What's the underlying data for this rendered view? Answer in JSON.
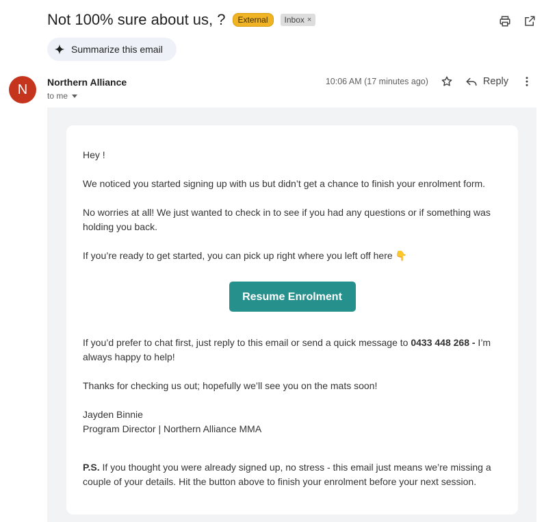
{
  "header": {
    "subject": "Not 100% sure about us, ?",
    "badge_external": "External",
    "badge_inbox": "Inbox",
    "badge_inbox_close": "×"
  },
  "toolbar": {
    "print_icon": "printer-icon",
    "open_new_window_icon": "open-in-new-icon"
  },
  "summarize": {
    "label": "Summarize this email",
    "icon": "sparkle-icon"
  },
  "message": {
    "avatar_letter": "N",
    "avatar_color": "#c5351e",
    "sender": "Northern Alliance",
    "recipient": "to me",
    "timestamp": "10:06 AM (17 minutes ago)",
    "reply_label": "Reply"
  },
  "body": {
    "greeting": "Hey !",
    "p1": "We noticed you started signing up with us but didn’t get a chance to finish your enrolment form.",
    "p2": "No worries at all! We just wanted to check in to see if you had any questions or if something was holding you back.",
    "p3": "If you’re ready to get started, you can pick up right where you left off here 👇",
    "cta_label": "Resume Enrolment",
    "cta_color": "#25908c",
    "p4_before": "If you’d prefer to chat first, just reply to this email or send a quick message to ",
    "p4_phone": "0433 448 268 -",
    "p4_after": " I’m always happy to help!",
    "p5": "Thanks for checking us out; hopefully we’ll see you on the mats soon!",
    "sig_name": "Jayden Binnie",
    "sig_title": "Program Director | Northern Alliance MMA",
    "ps_label": "P.S.",
    "ps_text": " If you thought you were already signed up, no stress - this email just means we’re missing a couple of your details. Hit the button above to finish your enrolment before your next session."
  }
}
